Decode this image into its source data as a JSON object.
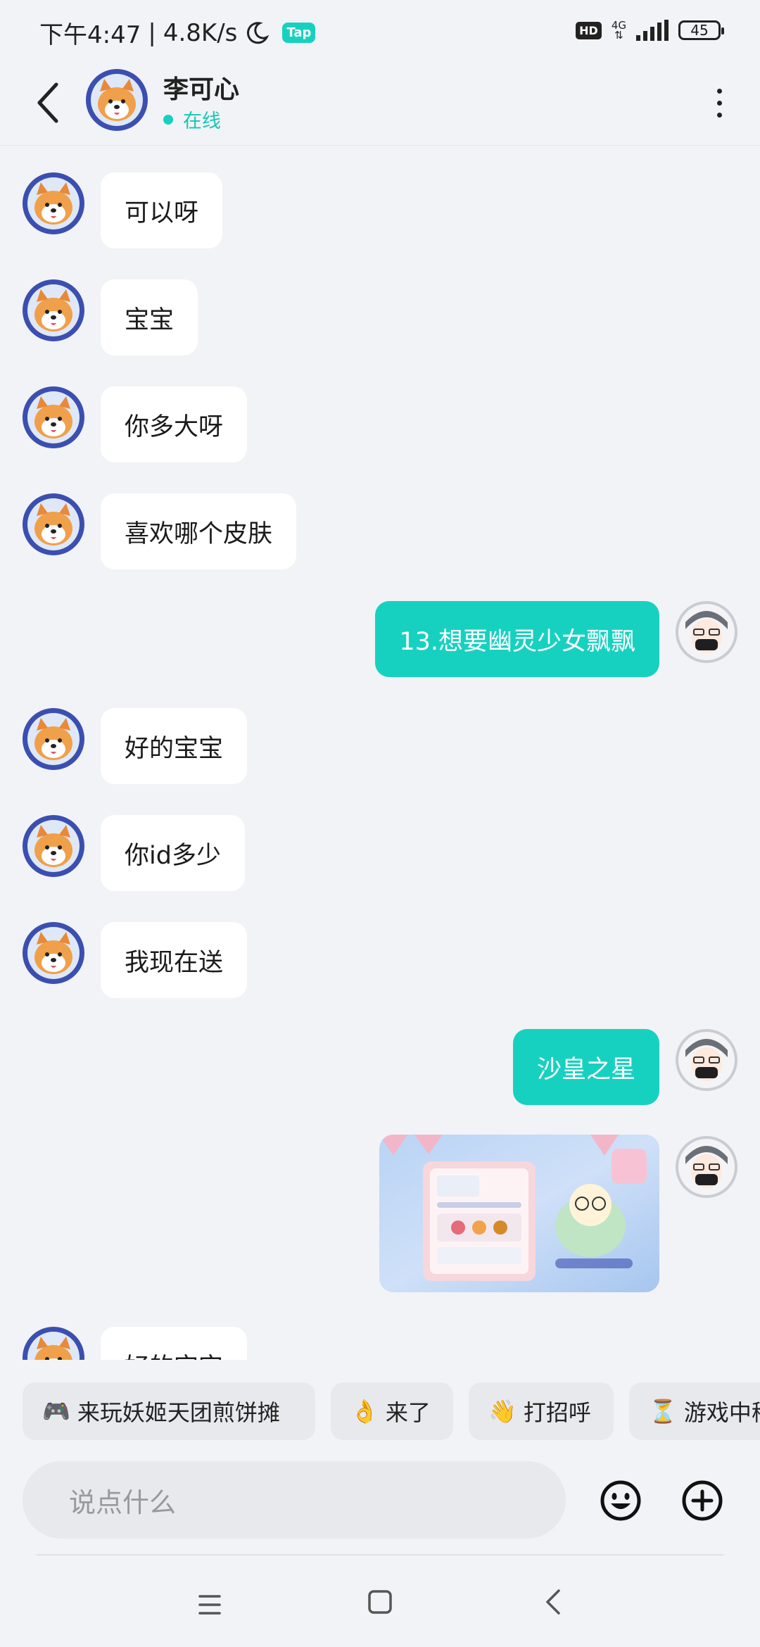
{
  "status_bar": {
    "time": "下午4:47",
    "speed": "4.8K/s",
    "app_badge": "Tap",
    "hd": "HD",
    "network": "4G",
    "battery": "45"
  },
  "header": {
    "name": "李可心",
    "status": "在线"
  },
  "messages": [
    {
      "side": "in",
      "text": "可以呀"
    },
    {
      "side": "in",
      "text": "宝宝"
    },
    {
      "side": "in",
      "text": "你多大呀"
    },
    {
      "side": "in",
      "text": "喜欢哪个皮肤"
    },
    {
      "side": "out",
      "text": "13.想要幽灵少女飘飘"
    },
    {
      "side": "in",
      "text": "好的宝宝"
    },
    {
      "side": "in",
      "text": "你id多少"
    },
    {
      "side": "in",
      "text": "我现在送"
    },
    {
      "side": "out",
      "text": "沙皇之星"
    },
    {
      "side": "out",
      "type": "image"
    },
    {
      "side": "in",
      "text": "好的宝宝"
    }
  ],
  "quick_replies": [
    {
      "icon": "🎮",
      "label": "来玩妖姬天团煎饼摊"
    },
    {
      "icon": "👌",
      "label": "来了"
    },
    {
      "icon": "👋",
      "label": "打招呼"
    },
    {
      "icon": "⏳",
      "label": "游戏中稍"
    }
  ],
  "input": {
    "placeholder": "说点什么"
  },
  "colors": {
    "accent": "#17d1c0",
    "background": "#f2f3f6",
    "bubble_in": "#ffffff"
  }
}
